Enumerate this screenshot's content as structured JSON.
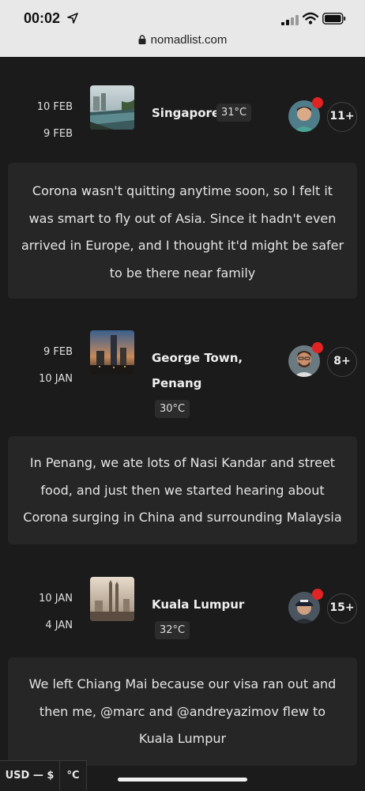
{
  "status_bar": {
    "time": "00:02",
    "url": "nomadlist.com"
  },
  "trips": [
    {
      "date_end": "10 FEB",
      "date_start": "9 FEB",
      "city_line1": "Singapore",
      "city_line2": "",
      "temperature": "31°C",
      "others_count": "11+",
      "note": "Corona wasn't quitting anytime soon, so I felt it was smart to fly out of Asia. Since it hadn't even arrived in Europe, and I thought it'd might be safer to be there near family"
    },
    {
      "date_end": "9 FEB",
      "date_start": "10 JAN",
      "city_line1": "George Town,",
      "city_line2": "Penang",
      "temperature": "30°C",
      "others_count": "8+",
      "note": "In Penang, we ate lots of Nasi Kandar and street food, and just then we started hearing about Corona surging in China and surrounding Malaysia"
    },
    {
      "date_end": "10 JAN",
      "date_start": "4 JAN",
      "city_line1": "Kuala Lumpur",
      "city_line2": "",
      "temperature": "32°C",
      "others_count": "15+",
      "note": "We left Chiang Mai because our visa ran out and then me, @marc and @andreyazimov flew to Kuala Lumpur"
    }
  ],
  "footer": {
    "currency": "USD — $",
    "unit": "°C"
  }
}
